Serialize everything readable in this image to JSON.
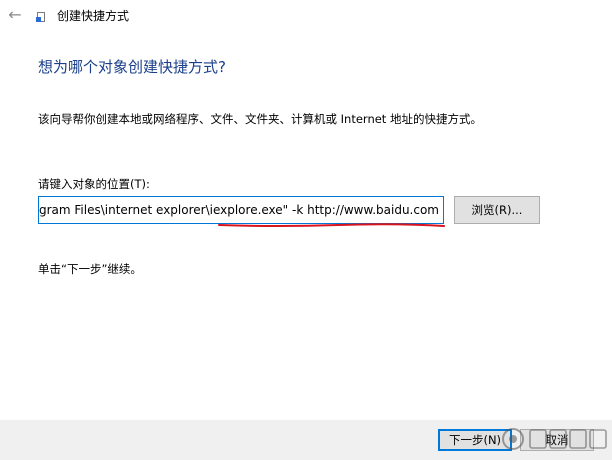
{
  "window": {
    "back_glyph": "←",
    "title": "创建快捷方式"
  },
  "wizard": {
    "heading": "想为哪个对象创建快捷方式?",
    "description": "该向导帮你创建本地或网络程序、文件、文件夹、计算机或 Internet 地址的快捷方式。",
    "location_label": "请键入对象的位置(T):",
    "location_value": "ogram Files\\internet explorer\\iexplore.exe\" -k http://www.baidu.com",
    "browse_label": "浏览(R)...",
    "hint": "单击“下一步”继续。"
  },
  "footer": {
    "next_label": "下一步(N)",
    "cancel_label": "取消"
  },
  "colors": {
    "heading": "#1a3f8a",
    "input_border": "#0078d7",
    "underline": "#d8141e",
    "footer_bg": "#f0f0f0"
  }
}
